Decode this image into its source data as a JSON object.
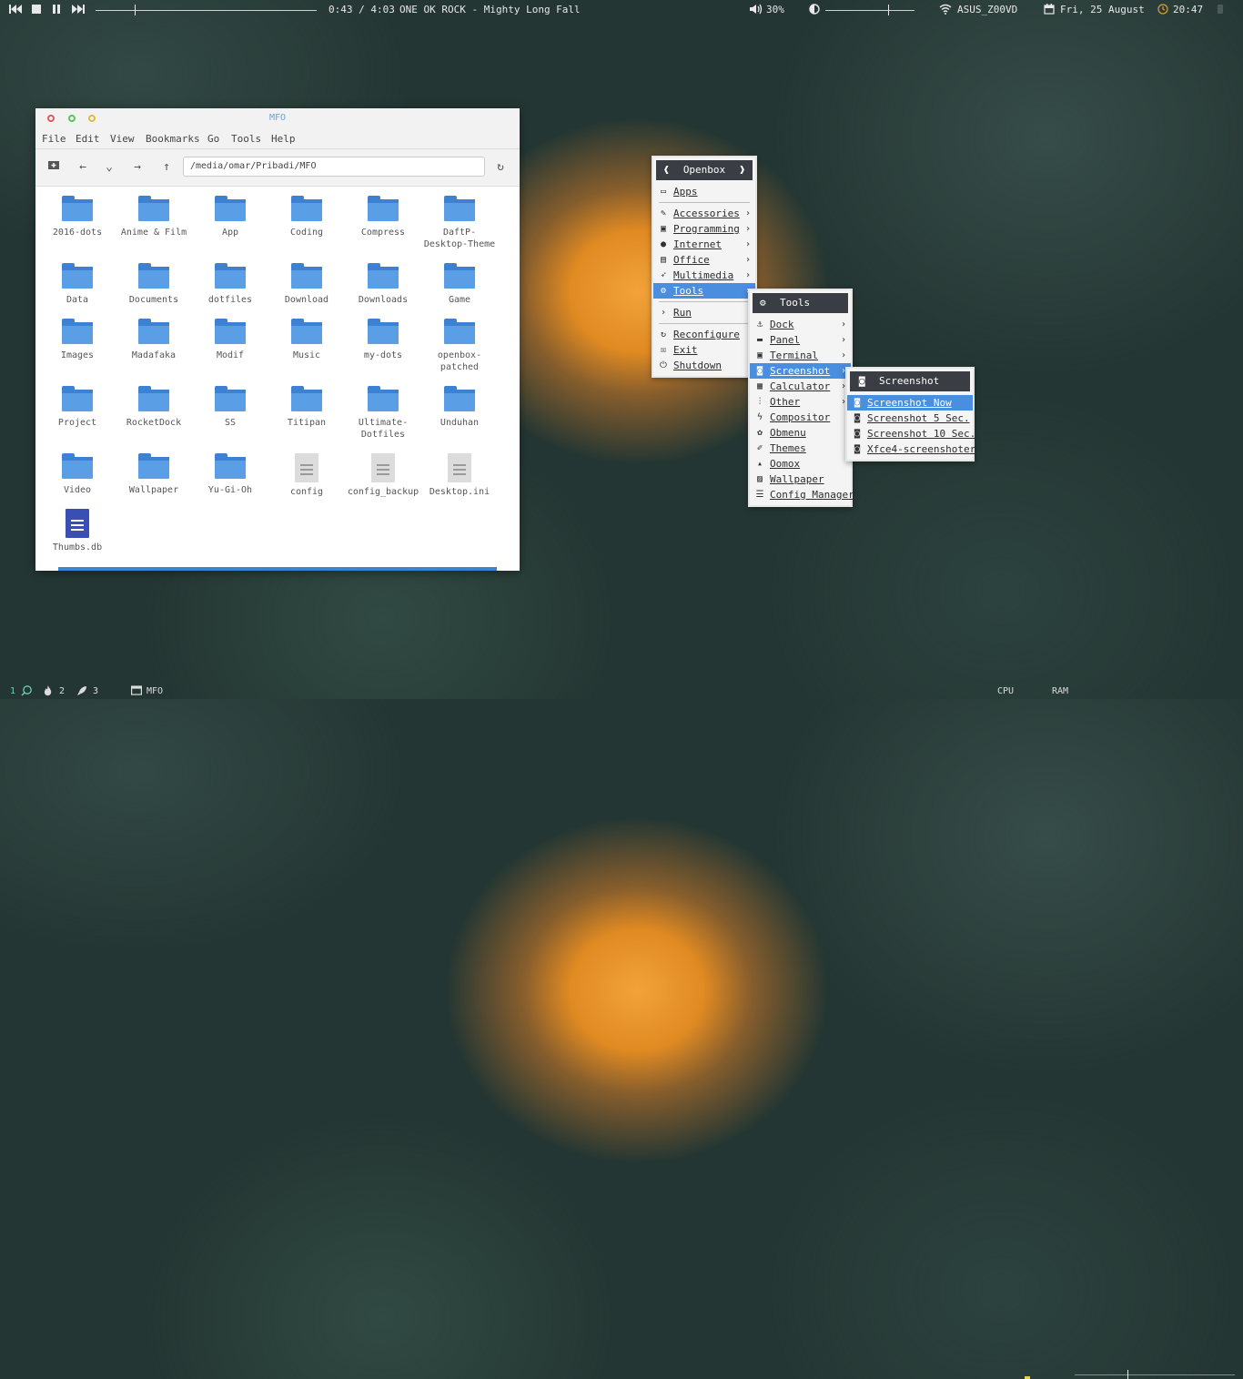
{
  "topbar": {
    "media_time": "0:43 / 4:03",
    "media_title": "ONE OK ROCK - Mighty Long Fall",
    "media_progress": 0.177,
    "volume": "30%",
    "brightness_level": 0.7,
    "wifi": "ASUS_Z00VD",
    "date": "Fri, 25 August",
    "time": "20:47"
  },
  "file_manager": {
    "title": "MFO",
    "menu": [
      "File",
      "Edit",
      "View",
      "Bookmarks",
      "Go",
      "Tools",
      "Help"
    ],
    "path": "/media/omar/Pribadi/MFO",
    "items": [
      {
        "name": "2016-dots",
        "type": "folder"
      },
      {
        "name": "Anime & Film",
        "type": "folder"
      },
      {
        "name": "App",
        "type": "folder"
      },
      {
        "name": "Coding",
        "type": "folder"
      },
      {
        "name": "Compress",
        "type": "folder"
      },
      {
        "name": "DaftP-\nDesktop-Theme",
        "type": "folder"
      },
      {
        "name": "Data",
        "type": "folder"
      },
      {
        "name": "Documents",
        "type": "folder"
      },
      {
        "name": "dotfiles",
        "type": "folder"
      },
      {
        "name": "Download",
        "type": "folder"
      },
      {
        "name": "Downloads",
        "type": "folder"
      },
      {
        "name": "Game",
        "type": "folder"
      },
      {
        "name": "Images",
        "type": "folder"
      },
      {
        "name": "Madafaka",
        "type": "folder"
      },
      {
        "name": "Modif",
        "type": "folder"
      },
      {
        "name": "Music",
        "type": "folder"
      },
      {
        "name": "my-dots",
        "type": "folder"
      },
      {
        "name": "openbox-\npatched",
        "type": "folder"
      },
      {
        "name": "Project",
        "type": "folder"
      },
      {
        "name": "RocketDock",
        "type": "folder"
      },
      {
        "name": "SS",
        "type": "folder"
      },
      {
        "name": "Titipan",
        "type": "folder"
      },
      {
        "name": "Ultimate-\nDotfiles",
        "type": "folder"
      },
      {
        "name": "Unduhan",
        "type": "folder"
      },
      {
        "name": "Video",
        "type": "folder"
      },
      {
        "name": "Wallpaper",
        "type": "folder"
      },
      {
        "name": "Yu-Gi-Oh",
        "type": "folder"
      },
      {
        "name": "config",
        "type": "file"
      },
      {
        "name": "config_backup",
        "type": "file"
      },
      {
        "name": "Desktop.ini",
        "type": "file"
      },
      {
        "name": "Thumbs.db",
        "type": "document"
      }
    ]
  },
  "openbox_menu": {
    "title": "Openbox",
    "apps": "Apps",
    "items": [
      "Accessories",
      "Programming",
      "Internet",
      "Office",
      "Multimedia",
      "Tools"
    ],
    "run": "Run",
    "reconfigure": "Reconfigure",
    "exit": "Exit",
    "shutdown": "Shutdown"
  },
  "tools_menu": {
    "title": "Tools",
    "items": [
      "Dock",
      "Panel",
      "Terminal",
      "Screenshot",
      "Calculator",
      "Other",
      "Compositor",
      "Obmenu",
      "Themes",
      "Oomox",
      "Wallpaper",
      "Config Manager"
    ]
  },
  "screenshot_menu": {
    "title": "Screenshot",
    "items": [
      "Screenshot Now",
      "Screenshot 5 Sec.",
      "Screenshot 10 Sec.",
      "Xfce4-screenshoter"
    ]
  },
  "bottombar": {
    "ws1": "1",
    "ws2": "2",
    "ws3": "3",
    "task": "MFO",
    "cpu_label": "CPU",
    "ram_label": "RAM",
    "ram_level": 0.33
  },
  "colors": {
    "accent": "#4a8ee0",
    "menu_header": "#3a3d44",
    "folder": "#5a9ee6",
    "active_workspace": "#6fcfb0"
  }
}
